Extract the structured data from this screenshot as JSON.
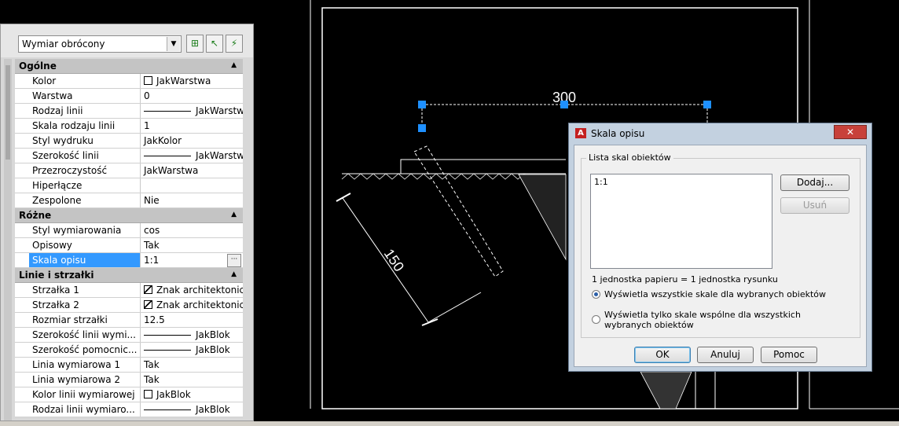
{
  "palette": {
    "object_type": "Wymiar obrócony",
    "categories": [
      {
        "title": "Ogólne",
        "rows": [
          {
            "name": "Kolor",
            "value": "JakWarstwa",
            "kind": "box"
          },
          {
            "name": "Warstwa",
            "value": "0",
            "kind": "text"
          },
          {
            "name": "Rodzaj linii",
            "value": "JakWarstwa",
            "kind": "line"
          },
          {
            "name": "Skala rodzaju linii",
            "value": "1",
            "kind": "text"
          },
          {
            "name": "Styl wydruku",
            "value": "JakKolor",
            "kind": "text"
          },
          {
            "name": "Szerokość linii",
            "value": "JakWarstwa",
            "kind": "line"
          },
          {
            "name": "Przezroczystość",
            "value": "JakWarstwa",
            "kind": "text"
          },
          {
            "name": "Hiperłącze",
            "value": "",
            "kind": "text"
          },
          {
            "name": "Zespolone",
            "value": "Nie",
            "kind": "text"
          }
        ]
      },
      {
        "title": "Różne",
        "rows": [
          {
            "name": "Styl wymiarowania",
            "value": "cos",
            "kind": "text"
          },
          {
            "name": "Opisowy",
            "value": "Tak",
            "kind": "text"
          },
          {
            "name": "Skala opisu",
            "value": "1:1",
            "kind": "text",
            "selected": true
          }
        ]
      },
      {
        "title": "Linie i strzałki",
        "rows": [
          {
            "name": "Strzałka 1",
            "value": "Znak architektoniczny",
            "kind": "hatch"
          },
          {
            "name": "Strzałka 2",
            "value": "Znak architektoniczny",
            "kind": "hatch"
          },
          {
            "name": "Rozmiar strzałki",
            "value": "12.5",
            "kind": "text"
          },
          {
            "name": "Szerokość linii wymi...",
            "value": "JakBlok",
            "kind": "line"
          },
          {
            "name": "Szerokość pomocnic...",
            "value": "JakBlok",
            "kind": "line"
          },
          {
            "name": "Linia wymiarowa 1",
            "value": "Tak",
            "kind": "text"
          },
          {
            "name": "Linia wymiarowa 2",
            "value": "Tak",
            "kind": "text"
          },
          {
            "name": "Kolor linii wymiarowej",
            "value": "JakBlok",
            "kind": "box"
          },
          {
            "name": "Rodzai linii wymiaro...",
            "value": "JakBlok",
            "kind": "line"
          }
        ]
      }
    ]
  },
  "drawing": {
    "dim_top": "300",
    "dim_slanted": "150",
    "grip_color": "#1e90ff"
  },
  "dialog": {
    "title": "Skala opisu",
    "close_label": "✕",
    "group_label": "Lista skal obiektów",
    "list_items": [
      "1:1"
    ],
    "add_label": "Dodaj...",
    "remove_label": "Usuń",
    "ratio_text": "1 jednostka papieru = 1 jednostka rysunku",
    "radio_all": "Wyświetla wszystkie skale dla wybranych obiektów",
    "radio_common": "Wyświetla tylko skale wspólne dla wszystkich wybranych obiektów",
    "ok_label": "OK",
    "cancel_label": "Anuluj",
    "help_label": "Pomoc"
  }
}
